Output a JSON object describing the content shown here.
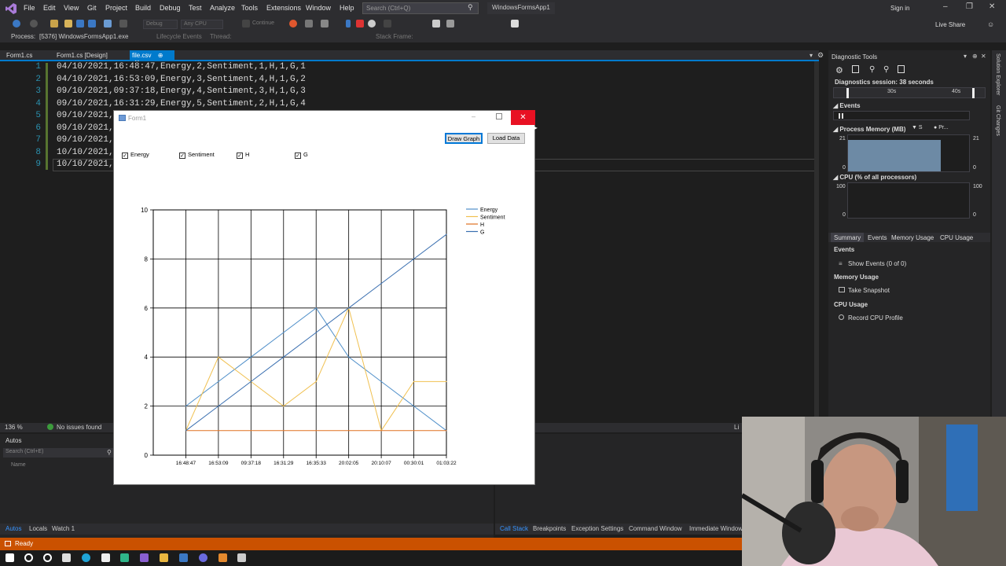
{
  "menubar": {
    "items": [
      "File",
      "Edit",
      "View",
      "Git",
      "Project",
      "Build",
      "Debug",
      "Test",
      "Analyze",
      "Tools",
      "Extensions",
      "Window",
      "Help"
    ],
    "search_placeholder": "Search (Ctrl+Q)",
    "solution_name": "WindowsFormsApp1",
    "signin": "Sign in"
  },
  "toolbar": {
    "config": "Debug",
    "platform": "Any CPU",
    "continue_label": "Continue",
    "live_share": "Live Share"
  },
  "process_bar": {
    "process_label": "Process:",
    "process_value": "[5376] WindowsFormsApp1.exe",
    "lifecycle": "Lifecycle Events",
    "thread": "Thread:",
    "stack_frame": "Stack Frame:"
  },
  "tabs": [
    {
      "label": "Form1.cs"
    },
    {
      "label": "Form1.cs [Design]"
    },
    {
      "label": "file.csv"
    }
  ],
  "editor": {
    "lines": [
      {
        "no": "1",
        "text": "04/10/2021,16:48:47,Energy,2,Sentiment,1,H,1,G,1"
      },
      {
        "no": "2",
        "text": "04/10/2021,16:53:09,Energy,3,Sentiment,4,H,1,G,2"
      },
      {
        "no": "3",
        "text": "09/10/2021,09:37:18,Energy,4,Sentiment,3,H,1,G,3"
      },
      {
        "no": "4",
        "text": "09/10/2021,16:31:29,Energy,5,Sentiment,2,H,1,G,4"
      },
      {
        "no": "5",
        "text": "09/10/2021,"
      },
      {
        "no": "6",
        "text": "09/10/2021,"
      },
      {
        "no": "7",
        "text": "09/10/2021,"
      },
      {
        "no": "8",
        "text": "10/10/2021,"
      },
      {
        "no": "9",
        "text": "10/10/2021,"
      }
    ],
    "zoom": "136 %",
    "issues": "No issues found",
    "ln_label": "Li"
  },
  "autos": {
    "title": "Autos",
    "search_placeholder": "Search (Ctrl+E)",
    "col_name": "Name",
    "tabs": [
      "Autos",
      "Locals",
      "Watch 1"
    ]
  },
  "bottom_tabs": [
    "Call Stack",
    "Breakpoints",
    "Exception Settings",
    "Command Window",
    "Immediate Window"
  ],
  "status": {
    "text": "Ready"
  },
  "diagnostics": {
    "title": "Diagnostic Tools",
    "session": "Diagnostics session: 38 seconds",
    "t30": "30s",
    "t40": "40s",
    "events_hdr": "Events",
    "memory_hdr": "Process Memory (MB)",
    "mem_legend": "S",
    "mem_legend2": "Pr...",
    "mem_max_left": "21",
    "mem_max_right": "21",
    "mem_min_left": "0",
    "mem_min_right": "0",
    "cpu_hdr": "CPU (% of all processors)",
    "cpu_max_left": "100",
    "cpu_max_right": "100",
    "cpu_min_left": "0",
    "cpu_min_right": "0",
    "tabs": [
      "Summary",
      "Events",
      "Memory Usage",
      "CPU Usage"
    ],
    "sec_events": "Events",
    "show_events": "Show Events (0 of 0)",
    "sec_memory": "Memory Usage",
    "take_snapshot": "Take Snapshot",
    "sec_cpu": "CPU Usage",
    "record_cpu": "Record CPU Profile",
    "side_labels": [
      "Solution Explorer",
      "Git Changes"
    ]
  },
  "form1": {
    "title": "Form1",
    "draw_button": "Draw Graph",
    "load_button": "Load Data",
    "checkboxes": [
      {
        "label": "Energy",
        "checked": true
      },
      {
        "label": "Sentiment",
        "checked": true
      },
      {
        "label": "H",
        "checked": true
      },
      {
        "label": "G",
        "checked": true
      }
    ]
  },
  "chart_data": {
    "type": "line",
    "categories": [
      "16:48:47",
      "16:53:09",
      "09:37:18",
      "16:31:29",
      "16:35:33",
      "20:02:05",
      "20:10:07",
      "00:30:01",
      "01:03:22"
    ],
    "ylim": [
      0,
      10
    ],
    "yticks": [
      0,
      2,
      4,
      6,
      8,
      10
    ],
    "grid": true,
    "legend_position": "right",
    "series": [
      {
        "name": "Energy",
        "color": "#4f8fc9",
        "values": [
          2,
          3,
          4,
          5,
          6,
          4,
          3,
          2,
          1
        ]
      },
      {
        "name": "Sentiment",
        "color": "#f0c050",
        "values": [
          1,
          4,
          3,
          2,
          3,
          6,
          1,
          3,
          3
        ]
      },
      {
        "name": "H",
        "color": "#e07020",
        "values": [
          1,
          1,
          1,
          1,
          1,
          1,
          1,
          1,
          1
        ]
      },
      {
        "name": "G",
        "color": "#3a6fb0",
        "values": [
          1,
          2,
          3,
          4,
          5,
          6,
          7,
          8,
          9
        ]
      }
    ]
  }
}
